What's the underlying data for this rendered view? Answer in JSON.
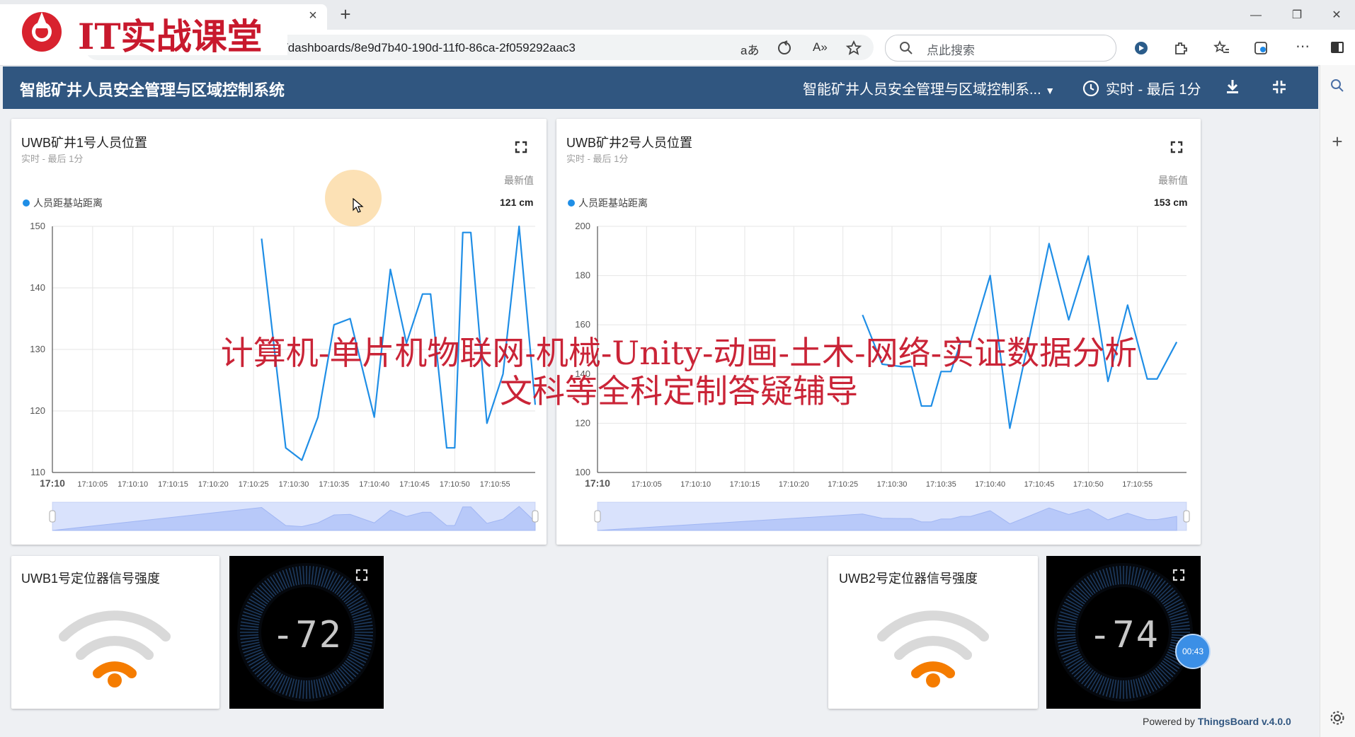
{
  "browser": {
    "tab_close_glyph": "×",
    "new_tab_glyph": "+",
    "url": "/dashboards/8e9d7b40-190d-11f0-86ca-2f059292aac3",
    "search_placeholder": "点此搜索",
    "translate_glyph": "aあ",
    "read_aloud_glyph": "A»",
    "window_minimize": "—",
    "window_restore": "❐",
    "window_close": "✕"
  },
  "logo": {
    "text": "IT实战课堂"
  },
  "dashboard": {
    "title": "智能矿井人员安全管理与区域控制系统",
    "selector": "智能矿井人员安全管理与区域控制系...",
    "timewindow": "实时 - 最后 1分"
  },
  "widgets": {
    "chart1": {
      "title": "UWB矿井1号人员位置",
      "subtitle": "实时 - 最后 1分",
      "latest_label": "最新值",
      "legend": "人员距基站距离",
      "latest_value": "121 cm"
    },
    "chart2": {
      "title": "UWB矿井2号人员位置",
      "subtitle": "实时 - 最后 1分",
      "latest_label": "最新值",
      "legend": "人员距基站距离",
      "latest_value": "153 cm"
    },
    "signal1": {
      "title": "UWB1号定位器信号强度"
    },
    "signal2": {
      "title": "UWB2号定位器信号强度"
    },
    "gauge1": {
      "value": "-72"
    },
    "gauge2": {
      "value": "-74"
    }
  },
  "watermark": {
    "line1": "计算机-单片机物联网-机械-Unity-动画-土木-网络-实证数据分析",
    "line2": "文科等全科定制答疑辅导"
  },
  "timer_badge": "00:43",
  "footer": {
    "powered_by": "Powered by ",
    "brand": "ThingsBoard v.4.0.0"
  },
  "colors": {
    "header": "#305680",
    "series": "#1f8ee6",
    "signal_active": "#f57c00",
    "signal_inactive": "#d9d9d9",
    "watermark": "#c8192d"
  },
  "chart_data": [
    {
      "type": "line",
      "title": "UWB矿井1号人员位置",
      "ylim": [
        110,
        150
      ],
      "yticks": [
        110,
        120,
        130,
        140,
        150
      ],
      "xticks": [
        "17:10",
        "17:10:05",
        "17:10:10",
        "17:10:15",
        "17:10:20",
        "17:10:25",
        "17:10:30",
        "17:10:35",
        "17:10:40",
        "17:10:45",
        "17:10:50",
        "17:10:55"
      ],
      "series": [
        {
          "name": "人员距基站距离",
          "points": [
            [
              26,
              148
            ],
            [
              29,
              114
            ],
            [
              31,
              112
            ],
            [
              33,
              119
            ],
            [
              35,
              134
            ],
            [
              37,
              135
            ],
            [
              40,
              119
            ],
            [
              42,
              143
            ],
            [
              44,
              131
            ],
            [
              46,
              139
            ],
            [
              47,
              139
            ],
            [
              49,
              114
            ],
            [
              50,
              114
            ],
            [
              51,
              149
            ],
            [
              52,
              149
            ],
            [
              54,
              118
            ],
            [
              56,
              126
            ],
            [
              58,
              150
            ],
            [
              60,
              121
            ]
          ]
        }
      ]
    },
    {
      "type": "line",
      "title": "UWB矿井2号人员位置",
      "ylim": [
        100,
        200
      ],
      "yticks": [
        100,
        120,
        140,
        160,
        180,
        200
      ],
      "xticks": [
        "17:10",
        "17:10:05",
        "17:10:10",
        "17:10:15",
        "17:10:20",
        "17:10:25",
        "17:10:30",
        "17:10:35",
        "17:10:40",
        "17:10:45",
        "17:10:50",
        "17:10:55"
      ],
      "series": [
        {
          "name": "人员距基站距离",
          "points": [
            [
              27,
              164
            ],
            [
              29,
              144
            ],
            [
              31,
              143
            ],
            [
              32,
              143
            ],
            [
              33,
              127
            ],
            [
              34,
              127
            ],
            [
              35,
              141
            ],
            [
              36,
              141
            ],
            [
              37,
              153
            ],
            [
              38,
              153
            ],
            [
              40,
              180
            ],
            [
              42,
              118
            ],
            [
              44,
              155
            ],
            [
              46,
              193
            ],
            [
              48,
              162
            ],
            [
              50,
              188
            ],
            [
              52,
              137
            ],
            [
              54,
              168
            ],
            [
              56,
              138
            ],
            [
              57,
              138
            ],
            [
              59,
              153
            ]
          ]
        }
      ]
    }
  ]
}
